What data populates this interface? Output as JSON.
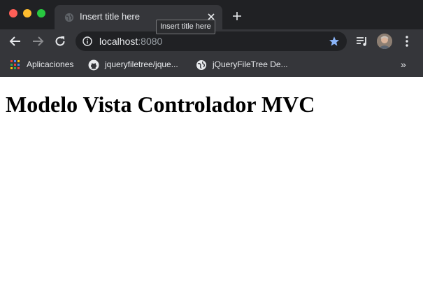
{
  "window": {
    "tab_title": "Insert title here",
    "tooltip": "Insert title here",
    "icons": {
      "traffic": [
        "close-dot-icon",
        "minimize-dot-icon",
        "zoom-dot-icon"
      ],
      "tab_favicon": "globe-icon",
      "tab_close": "close-icon",
      "new_tab": "plus-icon"
    }
  },
  "toolbar": {
    "url_host": "localhost",
    "url_port": ":8080",
    "icons": [
      "back-arrow-icon",
      "forward-arrow-icon",
      "reload-icon",
      "info-icon",
      "star-icon",
      "media-queue-icon",
      "avatar",
      "kebab-menu-icon"
    ],
    "star_color": "#8ab4f8"
  },
  "bookmarks": {
    "items": [
      {
        "label": "Aplicaciones",
        "icon": "apps-grid-icon"
      },
      {
        "label": "jqueryfiletree/jque...",
        "icon": "github-icon"
      },
      {
        "label": "jQueryFileTree De...",
        "icon": "globe-icon"
      }
    ],
    "more": "»"
  },
  "page": {
    "heading": "Modelo Vista Controlador MVC"
  }
}
